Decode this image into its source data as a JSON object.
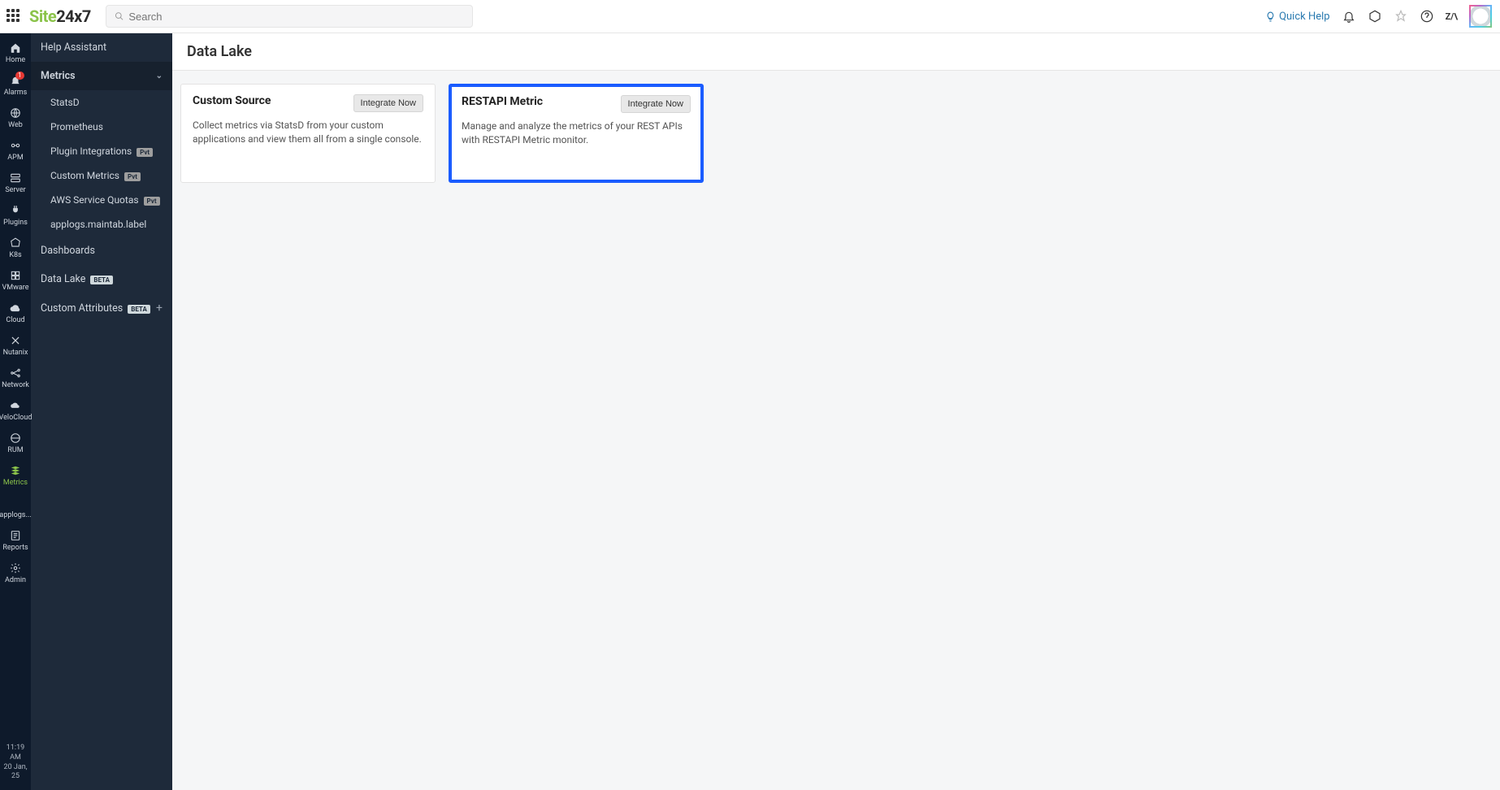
{
  "search": {
    "placeholder": "Search"
  },
  "topbar": {
    "quick_help": "Quick Help",
    "zoho": "Z/\\"
  },
  "rail": {
    "items": [
      {
        "label": "Home"
      },
      {
        "label": "Alarms",
        "badge": "1"
      },
      {
        "label": "Web"
      },
      {
        "label": "APM"
      },
      {
        "label": "Server"
      },
      {
        "label": "Plugins"
      },
      {
        "label": "K8s"
      },
      {
        "label": "VMware"
      },
      {
        "label": "Cloud"
      },
      {
        "label": "Nutanix"
      },
      {
        "label": "Network"
      },
      {
        "label": "VeloCloud"
      },
      {
        "label": "RUM"
      },
      {
        "label": "Metrics"
      },
      {
        "label": "applogs..."
      },
      {
        "label": "Reports"
      },
      {
        "label": "Admin"
      }
    ],
    "time": "11:19 AM",
    "date": "20 Jan, 25"
  },
  "sidepanel": {
    "help_assistant": "Help Assistant",
    "metrics": "Metrics",
    "subitems": [
      {
        "label": "StatsD"
      },
      {
        "label": "Prometheus"
      },
      {
        "label": "Plugin Integrations",
        "badge": "Pvt"
      },
      {
        "label": "Custom Metrics",
        "badge": "Pvt"
      },
      {
        "label": "AWS Service Quotas",
        "badge": "Pvt"
      },
      {
        "label": "applogs.maintab.label"
      }
    ],
    "dashboards": "Dashboards",
    "data_lake": "Data Lake",
    "data_lake_badge": "BETA",
    "custom_attributes": "Custom Attributes",
    "custom_attributes_badge": "BETA"
  },
  "page": {
    "title": "Data Lake"
  },
  "cards": [
    {
      "title": "Custom Source",
      "button": "Integrate Now",
      "desc": "Collect metrics via StatsD from your custom applications and view them all from a single console."
    },
    {
      "title": "RESTAPI Metric",
      "button": "Integrate Now",
      "desc": "Manage and analyze the metrics of your REST APIs with RESTAPI Metric monitor."
    }
  ]
}
